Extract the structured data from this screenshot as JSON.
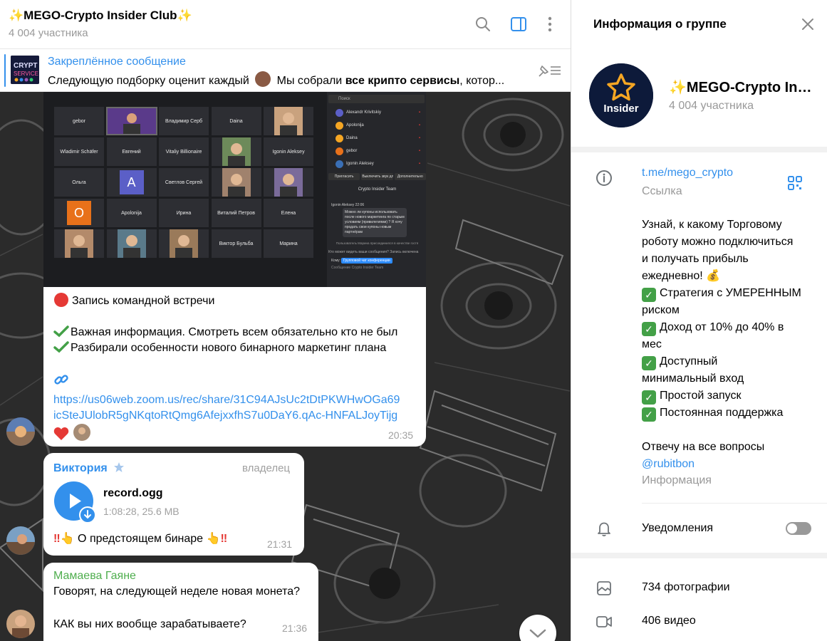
{
  "chat": {
    "title": "✨MEGO-Crypto Insider Club✨",
    "members": "4 004 участника",
    "pinned": {
      "title": "Закреплённое сообщение",
      "text_before": "Следующую подборку оценит каждый ",
      "text_middle": " Мы собрали ",
      "text_bold": "все крипто сервисы",
      "text_after": ", котор..."
    }
  },
  "video_grid": {
    "tiles": [
      "gebor",
      "",
      "Владимир Серб",
      "Daina",
      "",
      "Wladimir Schäfer",
      "Евгений",
      "Vitaliy Billionaire",
      "",
      "Igonin Aleksey",
      "Ольга",
      "A",
      "Светлов Сергей",
      "",
      "",
      "O",
      "Apolonija",
      "Ирина",
      "Виталий Петров",
      "Елена",
      "",
      "",
      "",
      "Виктор Бульба",
      "Марина"
    ],
    "sidebar_people": [
      "Alexandr Krivitskiy",
      "Apolonija",
      "Daina",
      "gebor",
      "Igonin Aleksey"
    ],
    "sidebar_search": "Поиск",
    "sidebar_buttons": [
      "Пригласить",
      "Выключить звук для всех",
      "Дополнительно"
    ],
    "chat_title": "Crypto Insider Team",
    "chat_author": "Igonin Aleksey  22:06",
    "chat_message": "Можно ли купоны использовать после нового маркетинга по старым условиям (привилегиями) ? Я хочу продать свои купоны новым партнёрам",
    "chat_notice": "Пользователь Марина присоединился в качестве гостя",
    "chat_input": "Кто может видеть ваши сообщения? Запись включена",
    "chat_to_label": "Кому:",
    "chat_to": "Групповой чат конференции",
    "chat_compose": "Сообщение Crypto Insider Team"
  },
  "messages": [
    {
      "line1": "Запись командной встречи",
      "line2": "Важная информация. Смотреть всем обязательно кто не был",
      "line3": "Разбирали особенности нового бинарного  маркетинг плана",
      "link_part1": "https://us06web.zoom.us/rec/share/31C94AJsUc2tDtPKWHwOGa69",
      "link_part2": "icSteJUlobR5gNKqtoRtQmg6AfejxxfhS7u0DaY6.qAc-HNFALJoyTijg",
      "time": "20:35"
    },
    {
      "author": "Виктория",
      "role": "владелец",
      "file_name": "record.ogg",
      "file_meta": "1:08:28, 25.6 MB",
      "text": "О предстоящем бинаре",
      "time": "21:31"
    },
    {
      "author": "Мамаева Гаяне",
      "line1": "Говорят, на следующей неделе новая монета?",
      "line2": "КАК вы них вообще зарабатываете?",
      "time": "21:36"
    }
  ],
  "info": {
    "title": "Информация о группе",
    "group_name": "✨MEGO-Crypto Insider Club✨",
    "avatar_text": "Insider",
    "members": "4 004 участника",
    "link": "t.me/mego_crypto",
    "link_label": "Ссылка",
    "description": [
      "Узнай, к какому Торговому",
      "роботу можно подключиться",
      "и получать прибыль",
      "ежедневно! 💰",
      "Стратегия с УМЕРЕННЫМ",
      "риском",
      "Доход от 10% до 40% в",
      "мес",
      "Доступный",
      "минимальный вход",
      "Простой запуск",
      "Постоянная поддержка",
      "Отвечу на все вопросы",
      "@rubitbon"
    ],
    "description_label": "Информация",
    "notifications_label": "Уведомления",
    "notifications_on": false,
    "photos": "734 фотографии",
    "videos": "406 видео"
  },
  "colors": {
    "accent": "#3390ec",
    "author_green": "#4fae4e",
    "check_green": "#43a047"
  }
}
